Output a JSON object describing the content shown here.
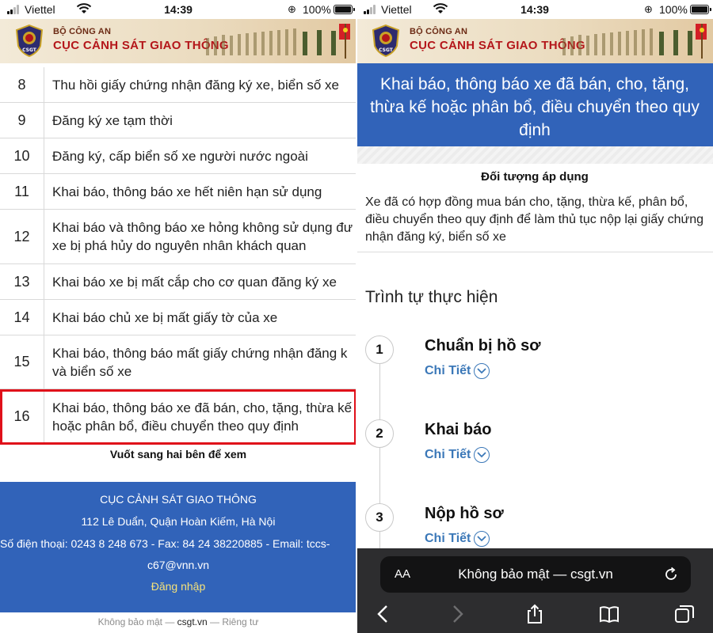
{
  "status_bar": {
    "carrier": "Viettel",
    "time": "14:39",
    "battery": "100%"
  },
  "banner": {
    "ministry": "BỘ CÔNG AN",
    "agency": "CỤC CẢNH SÁT GIAO THÔNG",
    "emblem_text": "CSGT"
  },
  "left": {
    "rows": [
      {
        "num": "8",
        "lines": [
          "Thu hồi giấy chứng nhận đăng ký xe, biển số xe"
        ]
      },
      {
        "num": "9",
        "lines": [
          "Đăng ký xe tạm thời"
        ]
      },
      {
        "num": "10",
        "lines": [
          "Đăng ký, cấp biển số xe người nước ngoài"
        ]
      },
      {
        "num": "11",
        "lines": [
          "Khai báo, thông báo xe hết niên hạn sử dụng"
        ]
      },
      {
        "num": "12",
        "lines": [
          "Khai báo và thông báo xe hỏng không sử dụng đư",
          "xe bị phá hủy do nguyên nhân khách quan"
        ]
      },
      {
        "num": "13",
        "lines": [
          "Khai báo xe bị mất cắp cho cơ quan đăng ký xe"
        ]
      },
      {
        "num": "14",
        "lines": [
          "Khai báo chủ xe bị mất giấy tờ của xe"
        ]
      },
      {
        "num": "15",
        "lines": [
          "Khai báo, thông báo mất giấy chứng nhận đăng k",
          "và biển số xe"
        ]
      },
      {
        "num": "16",
        "lines": [
          "Khai báo, thông báo xe đã bán, cho, tặng, thừa kế",
          "hoặc phân bổ, điều chuyển theo quy định"
        ]
      }
    ],
    "swipe_hint": "Vuốt sang hai bên để xem",
    "footer": {
      "org": "CỤC CẢNH SÁT GIAO THÔNG",
      "address": "112 Lê Duẩn, Quận Hoàn Kiếm, Hà Nội",
      "contact_line1": "Số điện thoại: 0243 8 248 673 - Fax: 84 24 38220885 - Email: tccs-",
      "contact_line2": "c67@vnn.vn",
      "login": "Đăng nhập"
    },
    "bottom_url": {
      "prefix": "Không bảo mật — ",
      "domain": "csgt.vn",
      "suffix": " — Riêng tư"
    }
  },
  "right": {
    "hero_title": "Khai báo, thông báo xe đã bán, cho, tặng, thừa kế hoặc phân bổ, điều chuyển theo quy định",
    "applies_heading": "Đối tượng áp dụng",
    "applies_body": "Xe đã có hợp đồng mua bán cho, tặng, thừa kế, phân bổ, điều chuyển theo quy định để làm thủ tục nộp lại giấy chứng nhận đăng ký, biển số xe",
    "sequence_title": "Trình tự thực hiện",
    "steps": [
      {
        "num": "1",
        "name": "Chuẩn bị hồ sơ",
        "detail": "Chi Tiết"
      },
      {
        "num": "2",
        "name": "Khai báo",
        "detail": "Chi Tiết"
      },
      {
        "num": "3",
        "name": "Nộp hồ sơ",
        "detail": "Chi Tiết"
      }
    ],
    "safari": {
      "aa": "AA",
      "address": "Không bảo mật — csgt.vn"
    }
  },
  "colors": {
    "header_blue": "#3163b9",
    "highlight_red": "#e0101a",
    "link_blue": "#3b78b8",
    "login_yellow": "#f5e27a"
  }
}
